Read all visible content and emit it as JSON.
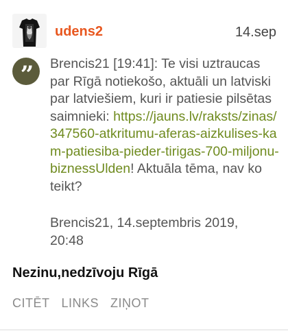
{
  "post": {
    "author": "udens2",
    "date": "14.sep",
    "quote": {
      "intro": "Brencis21 [19:41]: Te visi uztraucas par Rīgā notiekošo, aktuāli un latviski par latviešiem, kuri ir patiesie pilsētas saimnieki: ",
      "link": "https://jauns.lv/raksts/zinas/347560-atkritumu-aferas-aizkulises-kam-patiesiba-pieder-tirigas-700-miljonu-biznessUlden",
      "outro": "! Aktuāla tēma, nav ko teikt?",
      "meta_line1": "Brencis21, 14.septembris 2019,",
      "meta_line2": "20:48"
    },
    "reply": "Nezinu,nedzīvoju Rīgā",
    "actions": {
      "quote_label": "CITĒT",
      "links_label": "LINKS",
      "report_label": "ZIŅOT"
    }
  },
  "icons": {
    "avatar": "avatar-image",
    "quote": "quote-icon"
  },
  "colors": {
    "author": "#e8571f",
    "link": "#6f8b1f",
    "quote_badge": "#5b5b3b",
    "action": "#8a8a8a"
  }
}
